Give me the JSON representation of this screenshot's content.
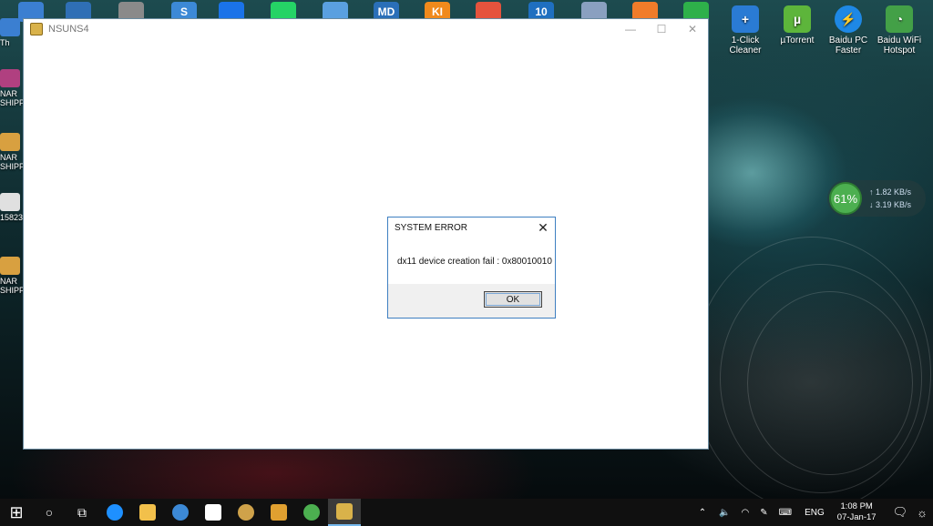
{
  "desktop": {
    "right_icons": [
      {
        "label": "1-Click Cleaner",
        "icon": "cleaner-icon",
        "color": "#2a7bd4"
      },
      {
        "label": "µTorrent",
        "icon": "utorrent-icon",
        "color": "#5db53b"
      },
      {
        "label": "Baidu PC Faster",
        "icon": "baidu-pc-faster-icon",
        "color": "#1e88e5"
      },
      {
        "label": "Baidu WiFi Hotspot",
        "icon": "wifi-hotspot-icon",
        "color": "#43a047"
      }
    ],
    "left_icons": [
      {
        "label": "Th",
        "color": "#3b7fd1"
      },
      {
        "label": "NAR SHIPP",
        "color": "#b04080"
      },
      {
        "label": "NAR SHIPP",
        "color": "#d8a040"
      },
      {
        "label": "15823",
        "color": "#e0e0e0"
      },
      {
        "label": "NAR SHIPP",
        "color": "#d8a040"
      }
    ],
    "top_icons": [
      {
        "label": "",
        "color": "#3b7fd1"
      },
      {
        "label": "",
        "color": "#2f6fb5"
      },
      {
        "label": "",
        "color": "#8a8a8a"
      },
      {
        "label": "S",
        "color": "#3c89d6"
      },
      {
        "label": "",
        "color": "#1a73e8"
      },
      {
        "label": "",
        "color": "#25d366"
      },
      {
        "label": "",
        "color": "#5aa0e0"
      },
      {
        "label": "MD",
        "color": "#2a6fb8"
      },
      {
        "label": "KI",
        "color": "#f08a1c"
      },
      {
        "label": "",
        "color": "#e5533d"
      },
      {
        "label": "10",
        "color": "#1f6fc0"
      },
      {
        "label": "",
        "color": "#8aa0c0"
      },
      {
        "label": "",
        "color": "#f07c2a"
      },
      {
        "label": "",
        "color": "#2eb04a"
      }
    ],
    "net_widget": {
      "percent": "61%",
      "up": "1.82 KB/s",
      "down": "3.19 KB/s"
    }
  },
  "window": {
    "title": "NSUNS4",
    "minimize": "—",
    "maximize": "☐",
    "close": "✕"
  },
  "dialog": {
    "title": "SYSTEM ERROR",
    "close": "✕",
    "message": "dx11 device creation fail : 0x80010010",
    "ok_label": "OK"
  },
  "taskbar": {
    "start": "⊞",
    "search": "○",
    "task_view": "⧉",
    "apps": [
      {
        "icon": "edge-icon",
        "color": "#1e90ff",
        "active": false
      },
      {
        "icon": "file-explorer-icon",
        "color": "#f2c04b",
        "active": false
      },
      {
        "icon": "browser-icon",
        "color": "#3c89d6",
        "active": false
      },
      {
        "icon": "store-icon",
        "color": "#ffffff",
        "active": false
      },
      {
        "icon": "paint-icon",
        "color": "#cfa24a",
        "active": false
      },
      {
        "icon": "tool-icon",
        "color": "#e0a030",
        "active": false
      },
      {
        "icon": "downloader-icon",
        "color": "#4caf50",
        "active": false
      },
      {
        "icon": "nsuns4-icon",
        "color": "#d9b24a",
        "active": true
      }
    ],
    "tray": {
      "language": "ENG",
      "time": "1:08 PM",
      "date": "07-Jan-17"
    }
  }
}
